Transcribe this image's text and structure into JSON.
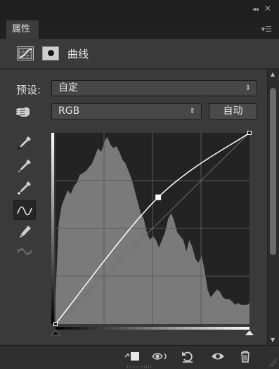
{
  "window": {
    "collapse_glyph": "◂◂",
    "close_glyph": "✕"
  },
  "tab": {
    "label": "属性",
    "menu_glyph": "▾☰"
  },
  "header": {
    "title": "曲线",
    "adjustment_icon": "curves-adjustment-icon",
    "mask_icon": "layer-mask-icon"
  },
  "preset": {
    "label": "预设:",
    "value": "自定",
    "arrow": "⇕"
  },
  "channel": {
    "value": "RGB",
    "arrow": "⇕",
    "auto_label": "自动"
  },
  "tools": [
    "targeted-adjustment-hand-icon",
    "black-point-eyedropper-icon",
    "gray-point-eyedropper-icon",
    "white-point-eyedropper-icon",
    "curve-point-tool-icon",
    "pencil-tool-icon",
    "smooth-curve-icon"
  ],
  "curve": {
    "input_range": [
      0,
      255
    ],
    "output_range": [
      0,
      255
    ],
    "points": [
      [
        0,
        0
      ],
      [
        135,
        169
      ],
      [
        255,
        255
      ]
    ],
    "grid": "4x4",
    "histogram_color": "#7a7a7a",
    "curve_color": "#ffffff",
    "background": "#232323"
  },
  "footer": {
    "buttons": [
      "clip-to-layer-icon",
      "view-previous-state-icon",
      "reset-adjustments-icon",
      "toggle-visibility-icon",
      "delete-adjustment-icon"
    ]
  },
  "colors": {
    "panel_bg": "#3a3a3a",
    "dark_bg": "#1f1f1f",
    "text": "#e0e0e0"
  }
}
